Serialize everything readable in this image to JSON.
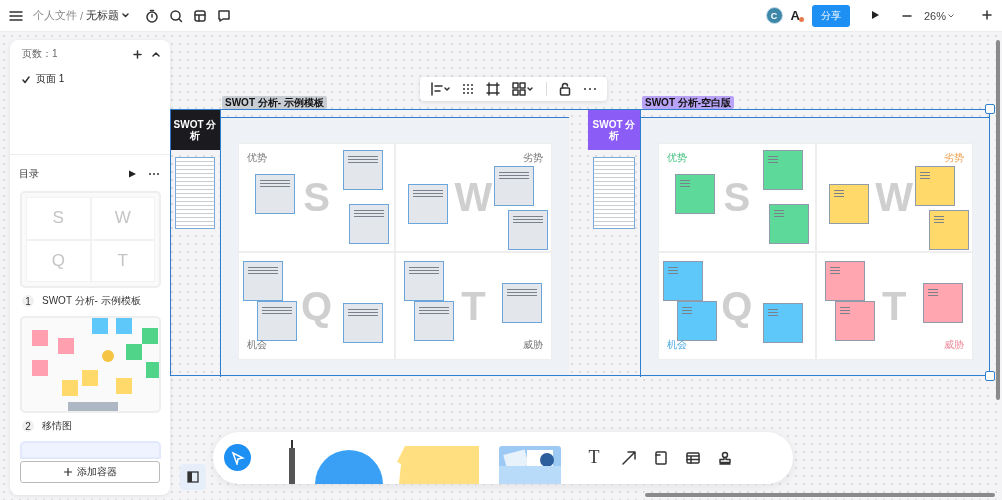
{
  "topbar": {
    "breadcrumb": [
      "个人文件",
      "无标题"
    ],
    "breadcrumb_separator": "/",
    "avatar": "C",
    "font_button": "A",
    "share": "分享",
    "zoom": "26%"
  },
  "pages_panel": {
    "count_label": "页数：1",
    "pages": [
      {
        "name": "页面 1",
        "selected": true
      }
    ]
  },
  "outline": {
    "title": "目录",
    "items": [
      {
        "kind": "swot",
        "number": "1",
        "title": "SWOT 分析- 示例模板",
        "letters": [
          "S",
          "W",
          "Q",
          "T"
        ]
      },
      {
        "kind": "empathy",
        "number": "2",
        "title": "移情图"
      },
      {
        "kind": "blank"
      }
    ],
    "add_button": "添加容器"
  },
  "frames": [
    {
      "kind": "template",
      "label": "SWOT 分析- 示例模板",
      "header": "SWOT 分析",
      "quadrants": [
        {
          "title": "优势",
          "letter": "S"
        },
        {
          "title": "劣势",
          "letter": "W"
        },
        {
          "title": "机会",
          "letter": "Q"
        },
        {
          "title": "威胁",
          "letter": "T"
        }
      ]
    },
    {
      "kind": "blank",
      "label": "SWOT 分析-空白版",
      "header": "SWOT 分析",
      "quadrants": [
        {
          "title": "优势",
          "letter": "S",
          "color": "#5dd99a"
        },
        {
          "title": "劣势",
          "letter": "W",
          "color": "#ffd96a"
        },
        {
          "title": "机会",
          "letter": "Q",
          "color": "#5ec8fb"
        },
        {
          "title": "威胁",
          "letter": "T",
          "color": "#ffa6b0"
        }
      ]
    }
  ],
  "toolbar": {
    "text_tool": "T"
  }
}
